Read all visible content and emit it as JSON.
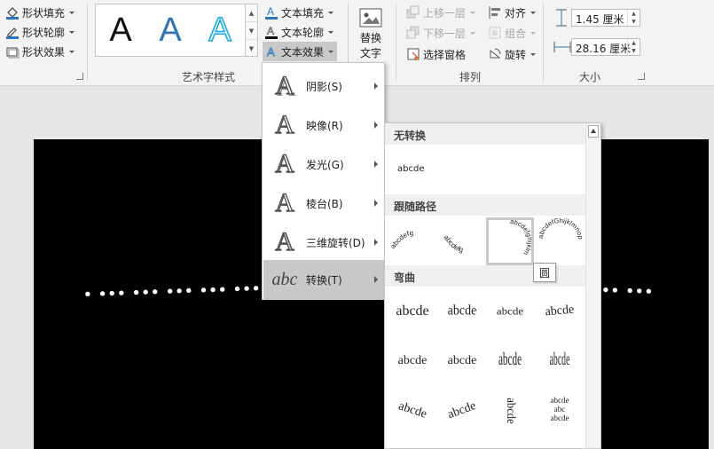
{
  "shape_styles": {
    "fill": "形状填充",
    "outline": "形状轮廓",
    "effects": "形状效果"
  },
  "wordart": {
    "group_label": "艺术字样式",
    "gallery": [
      {
        "glyph": "A",
        "style": "black"
      },
      {
        "glyph": "A",
        "style": "blue-gradient"
      },
      {
        "glyph": "A",
        "style": "cyan-outline"
      }
    ],
    "text_fill": "文本填充",
    "text_outline": "文本轮廓",
    "text_effects": "文本效果"
  },
  "accessibility": {
    "alt_text_line1": "替换",
    "alt_text_line2": "文字"
  },
  "arrange": {
    "group_label": "排列",
    "bring_forward": "上移一层",
    "send_backward": "下移一层",
    "selection_pane": "选择窗格",
    "align": "对齐",
    "group": "组合",
    "rotate": "旋转"
  },
  "size": {
    "group_label": "大小",
    "height": "1.45 厘米",
    "width": "28.16 厘米"
  },
  "slide": {
    "dots_left": "• ••• ••• ••• ••• ••• •••",
    "dots_right": "•• •••"
  },
  "effects_menu": {
    "items": [
      {
        "label": "阴影(S)",
        "icon": "A"
      },
      {
        "label": "映像(R)",
        "icon": "A"
      },
      {
        "label": "发光(G)",
        "icon": "A"
      },
      {
        "label": "棱台(B)",
        "icon": "A"
      },
      {
        "label": "三维旋转(D)",
        "icon": "A"
      },
      {
        "label": "转换(T)",
        "icon": "abc"
      }
    ]
  },
  "transform_gallery": {
    "no_transform_header": "无转换",
    "no_transform_sample": "abcde",
    "follow_path_header": "跟随路径",
    "path_samples": [
      "abcdefg",
      "abcdefg",
      "abcdefghijklm",
      "abcdefGhijklmnop"
    ],
    "warp_header": "弯曲",
    "warp_samples": [
      "abcde",
      "abcde",
      "abcde",
      "abcde",
      "abcde",
      "abcde",
      "abcde",
      "abcde",
      "abcde",
      "abcde",
      "abcde",
      "abcde"
    ],
    "stack_sample": [
      "abcde",
      "abc",
      "abcde"
    ],
    "tooltip": "圆"
  },
  "colors": {
    "accent_blue": "#2e75b6",
    "cyan": "#22a6d6",
    "menu_active": "#c8c8c8"
  }
}
